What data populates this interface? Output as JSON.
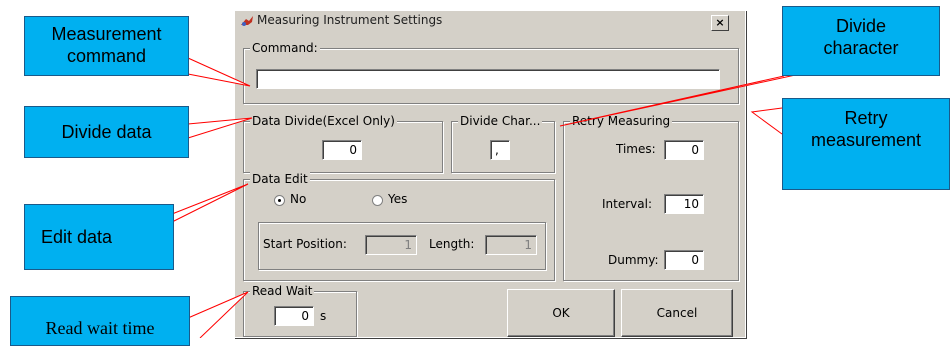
{
  "dialog": {
    "title": "Measuring Instrument Settings",
    "close_label": "×",
    "command": {
      "legend": "Command:",
      "value": ""
    },
    "data_divide": {
      "legend": "Data Divide(Excel Only)",
      "value": "0"
    },
    "divide_char": {
      "legend": "Divide Char...",
      "value": ","
    },
    "retry": {
      "legend": "Retry Measuring",
      "times_label": "Times:",
      "times_value": "0",
      "interval_label": "Interval:",
      "interval_value": "10",
      "dummy_label": "Dummy:",
      "dummy_value": "0"
    },
    "data_edit": {
      "legend": "Data Edit",
      "no_label": "No",
      "yes_label": "Yes",
      "selected": "No",
      "start_label": "Start Position:",
      "start_value": "1",
      "length_label": "Length:",
      "length_value": "1"
    },
    "read_wait": {
      "legend": "Read Wait",
      "value": "0",
      "unit": "s"
    },
    "ok_label": "OK",
    "cancel_label": "Cancel"
  },
  "callouts": {
    "measurement_command": "Measurement command",
    "divide_data": "Divide data",
    "edit_data": "Edit data",
    "read_wait_time": "Read wait time",
    "divide_character": "Divide character",
    "retry_measurement": "Retry measurement"
  },
  "colors": {
    "callout_fill": "#00b0f0",
    "leader_line": "#ff0000",
    "dialog_face": "#d4d0c8"
  }
}
